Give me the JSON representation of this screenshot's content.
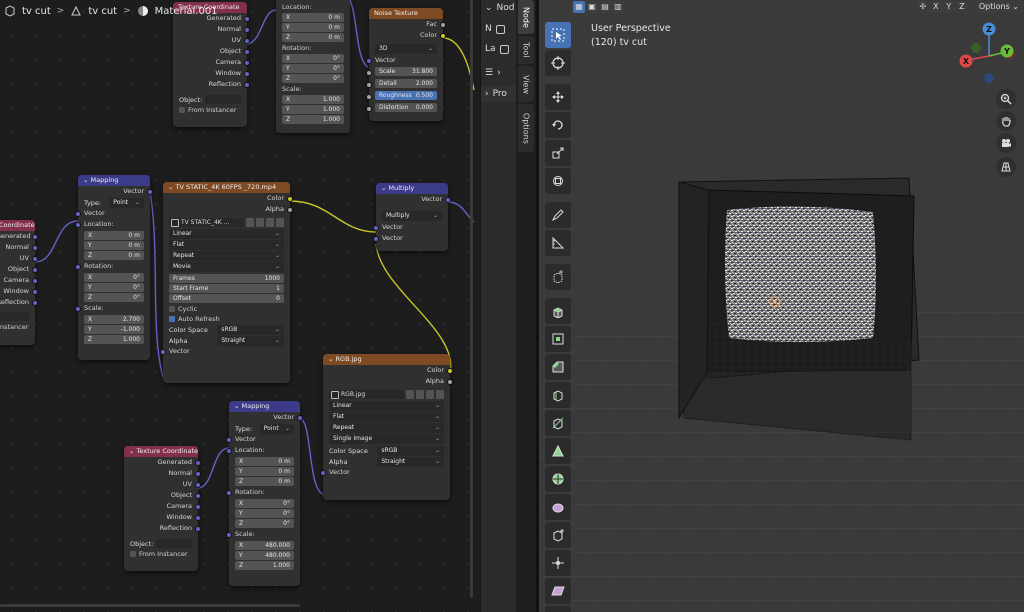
{
  "breadcrumb": {
    "object": "tv cut",
    "mesh": "tv cut",
    "material": "Material.001"
  },
  "colors": {
    "input_header": "#83314a",
    "vector_header": "#3b3b8a",
    "texture_header": "#7e4a23",
    "vector_socket": "#6363c7",
    "color_socket": "#c7c729",
    "float_socket": "#a1a1a1",
    "accent": "#4772b3"
  },
  "nodes": {
    "texcoord_top": {
      "title": "Texture Coordinate",
      "outputs": [
        "Generated",
        "Normal",
        "UV",
        "Object",
        "Camera",
        "Window",
        "Reflection"
      ],
      "object_label": "Object:",
      "from_instancer": "From Instancer"
    },
    "mapping_top": {
      "location_label": "Location:",
      "loc": {
        "x_label": "X",
        "x": "0 m",
        "y_label": "Y",
        "y": "0 m",
        "z_label": "Z",
        "z": "0 m"
      },
      "rotation_label": "Rotation:",
      "rot": {
        "x_label": "X",
        "x": "0°",
        "y_label": "Y",
        "y": "0°",
        "z_label": "Z",
        "z": "0°"
      },
      "scale_label": "Scale:",
      "scale": {
        "x_label": "X",
        "x": "1.000",
        "y_label": "Y",
        "y": "1.000",
        "z_label": "Z",
        "z": "1.000"
      }
    },
    "noise": {
      "title": "Noise Texture",
      "out_fac": "Fac",
      "out_color": "Color",
      "dimension": "3D",
      "in_vector": "Vector",
      "scale_label": "Scale",
      "scale": "31.800",
      "detail_label": "Detail",
      "detail": "2.000",
      "roughness_label": "Roughness",
      "roughness": "0.500",
      "distortion_label": "Distortion",
      "distortion": "0.000"
    },
    "texcoord_left": {
      "title": "Coordinate",
      "outputs": [
        "Generated",
        "Normal",
        "UV",
        "Object",
        "Camera",
        "Window",
        "Reflection"
      ],
      "from_instancer": "nstancer"
    },
    "mapping_mid": {
      "title": "Mapping",
      "out_vector": "Vector",
      "type_label": "Type:",
      "type_value": "Point",
      "in_vector": "Vector",
      "location_label": "Location:",
      "loc": {
        "x_label": "X",
        "x": "0 m",
        "y_label": "Y",
        "y": "0 m",
        "z_label": "Z",
        "z": "0 m"
      },
      "rotation_label": "Rotation:",
      "rot": {
        "x_label": "X",
        "x": "0°",
        "y_label": "Y",
        "y": "0°",
        "z_label": "Z",
        "z": "0°"
      },
      "scale_label": "Scale:",
      "scale": {
        "x_label": "X",
        "x": "2.700",
        "y_label": "Y",
        "y": "-1.000",
        "z_label": "Z",
        "z": "1.000"
      }
    },
    "movie": {
      "title": "TV STATIC_4K 60FPS _720.mp4",
      "out_color": "Color",
      "out_alpha": "Alpha",
      "image_name": "TV STATIC_4K ...",
      "interpolation": "Linear",
      "projection": "Flat",
      "extension": "Repeat",
      "source": "Movie",
      "frames_label": "Frames",
      "frames": "1000",
      "start_label": "Start Frame",
      "start": "1",
      "offset_label": "Offset",
      "offset": "0",
      "cyclic": "Cyclic",
      "auto_refresh": "Auto Refresh",
      "colorspace_label": "Color Space",
      "colorspace": "sRGB",
      "alpha_label": "Alpha",
      "alpha": "Straight",
      "in_vector": "Vector"
    },
    "multiply": {
      "title": "Multiply",
      "out_vector": "Vector",
      "operation": "Multiply",
      "in_vector1": "Vector",
      "in_vector2": "Vector"
    },
    "rgb": {
      "title": "RGB.jpg",
      "out_color": "Color",
      "out_alpha": "Alpha",
      "image_name": "RGB.jpg",
      "interpolation": "Linear",
      "projection": "Flat",
      "extension": "Repeat",
      "source": "Single Image",
      "colorspace_label": "Color Space",
      "colorspace": "sRGB",
      "alpha_label": "Alpha",
      "alpha": "Straight",
      "in_vector": "Vector"
    },
    "mapping_bottom": {
      "title": "Mapping",
      "out_vector": "Vector",
      "type_label": "Type:",
      "type_value": "Point",
      "in_vector": "Vector",
      "location_label": "Location:",
      "loc": {
        "x_label": "X",
        "x": "0 m",
        "y_label": "Y",
        "y": "0 m",
        "z_label": "Z",
        "z": "0 m"
      },
      "rotation_label": "Rotation:",
      "rot": {
        "x_label": "X",
        "x": "0°",
        "y_label": "Y",
        "y": "0°",
        "z_label": "Z",
        "z": "0°"
      },
      "scale_label": "Scale:",
      "scale": {
        "x_label": "X",
        "x": "480.000",
        "y_label": "Y",
        "y": "480.000",
        "z_label": "Z",
        "z": "1.000"
      }
    },
    "texcoord_bottom": {
      "title": "Texture Coordinate",
      "outputs": [
        "Generated",
        "Normal",
        "UV",
        "Object",
        "Camera",
        "Window",
        "Reflection"
      ],
      "object_label": "Object:",
      "from_instancer": "From Instancer"
    }
  },
  "sidebar": {
    "item1": "Nod",
    "item2": "N",
    "item3": "La",
    "item4": "Pro",
    "tabs": [
      "Node",
      "Tool",
      "View",
      "Options"
    ]
  },
  "viewport": {
    "header": {
      "x": "X",
      "y": "Y",
      "z": "Z",
      "options": "Options"
    },
    "title": "User Perspective",
    "subtitle": "(120) tv cut",
    "gizmo": {
      "x": "X",
      "y": "Y",
      "z": "Z"
    }
  }
}
